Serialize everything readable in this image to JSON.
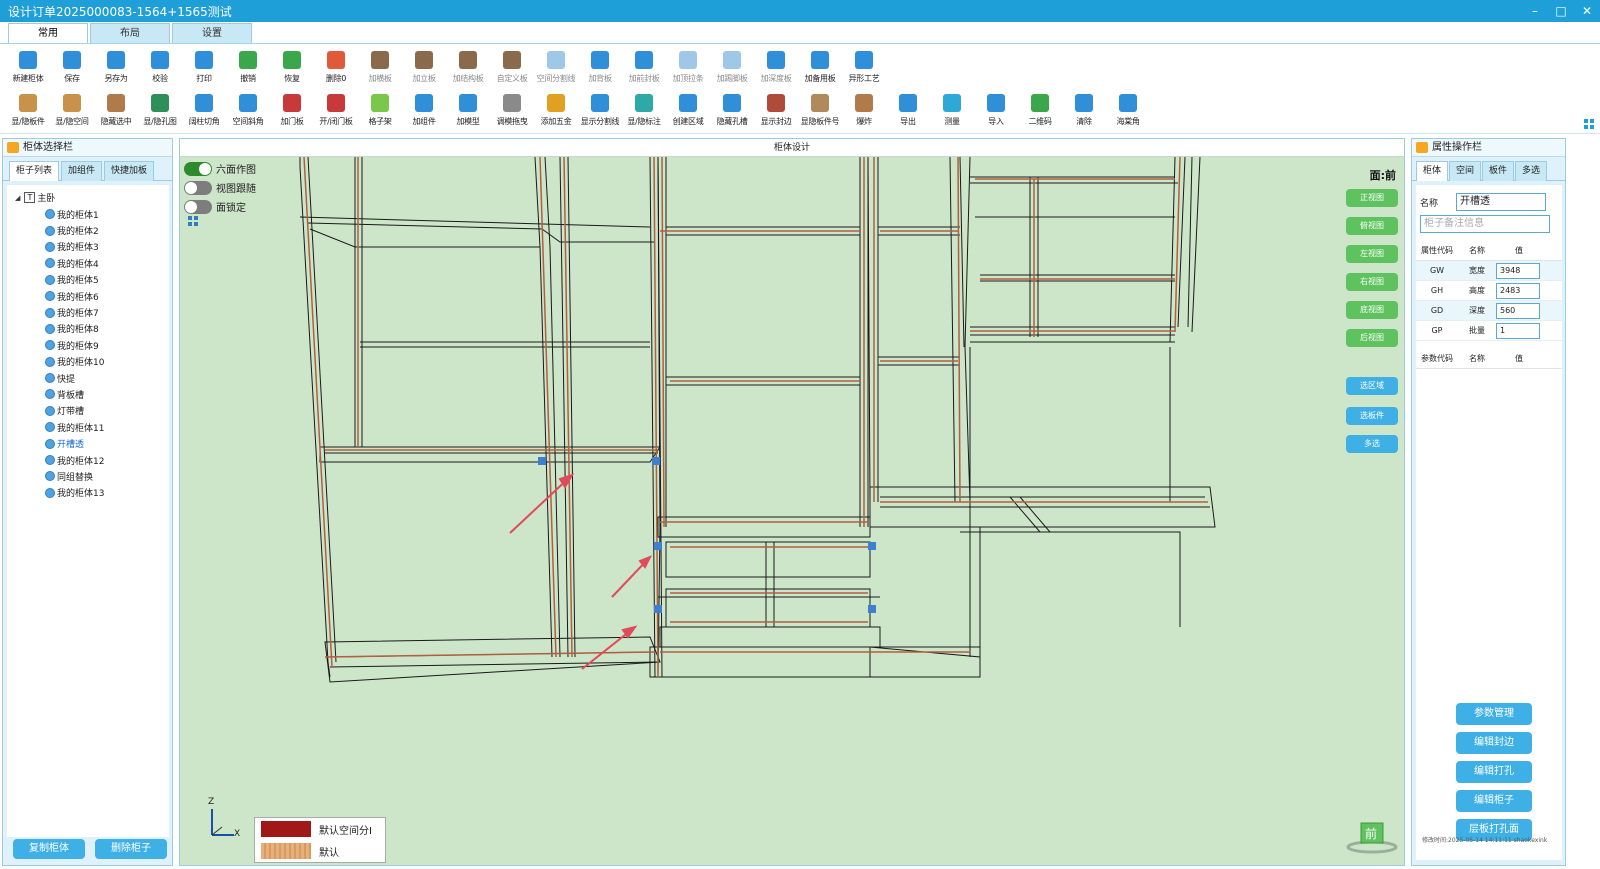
{
  "window": {
    "title": "设计订单2025000083-1564+1565测试",
    "controls": [
      "–",
      "□",
      "✕"
    ]
  },
  "ribbon": {
    "tabs": [
      "常用",
      "布局",
      "设置"
    ],
    "active_tab": "常用",
    "row1": [
      {
        "label": "新建柜体",
        "icon": "new-cabinet-icon",
        "color": "#2f8fd8",
        "dim": false
      },
      {
        "label": "保存",
        "icon": "save-icon",
        "color": "#2f8fd8",
        "dim": false
      },
      {
        "label": "另存为",
        "icon": "save-as-icon",
        "color": "#2f8fd8",
        "dim": false
      },
      {
        "label": "校验",
        "icon": "check-icon",
        "color": "#2f8fd8",
        "dim": false
      },
      {
        "label": "打印",
        "icon": "print-icon",
        "color": "#2f8fd8",
        "dim": false
      },
      {
        "label": "撤销",
        "icon": "undo-icon",
        "color": "#3aa84a",
        "dim": false
      },
      {
        "label": "恢复",
        "icon": "redo-icon",
        "color": "#3aa84a",
        "dim": false
      },
      {
        "label": "删除0",
        "icon": "delete-icon",
        "color": "#e05a3a",
        "dim": false
      },
      {
        "label": "加横板",
        "icon": "add-horizontal-board-icon",
        "color": "#8a6a4a",
        "dim": true
      },
      {
        "label": "加立板",
        "icon": "add-vertical-board-icon",
        "color": "#8a6a4a",
        "dim": true
      },
      {
        "label": "加结构板",
        "icon": "add-structure-board-icon",
        "color": "#8a6a4a",
        "dim": true
      },
      {
        "label": "自定义板",
        "icon": "custom-board-icon",
        "color": "#8a6a4a",
        "dim": true
      },
      {
        "label": "空间分割线",
        "icon": "space-split-line-icon",
        "color": "#9fc8e8",
        "dim": true
      },
      {
        "label": "加背板",
        "icon": "add-back-board-icon",
        "color": "#2f8fd8",
        "dim": true
      },
      {
        "label": "加前封板",
        "icon": "add-front-seal-board-icon",
        "color": "#2f8fd8",
        "dim": true
      },
      {
        "label": "加顶拉条",
        "icon": "add-top-strip-icon",
        "color": "#9fc8e8",
        "dim": true
      },
      {
        "label": "加踢脚板",
        "icon": "add-kick-board-icon",
        "color": "#9fc8e8",
        "dim": true
      },
      {
        "label": "加深度板",
        "icon": "add-depth-board-icon",
        "color": "#2f8fd8",
        "dim": true
      },
      {
        "label": "加备用板",
        "icon": "add-spare-board-icon",
        "color": "#2f8fd8",
        "dim": false
      },
      {
        "label": "异形工艺",
        "icon": "special-process-icon",
        "color": "#2f8fd8",
        "dim": false
      }
    ],
    "row2": [
      {
        "label": "显/隐板件",
        "icon": "toggle-boards-icon",
        "color": "#c8924a"
      },
      {
        "label": "显/隐空间",
        "icon": "toggle-space-icon",
        "color": "#c8924a"
      },
      {
        "label": "隐藏选中",
        "icon": "hide-selected-icon",
        "color": "#b07a4a"
      },
      {
        "label": "显/隐孔图",
        "icon": "toggle-hole-map-icon",
        "color": "#2f8f5a"
      },
      {
        "label": "阔柱切角",
        "icon": "column-cut-corner-icon",
        "color": "#2f8fd8"
      },
      {
        "label": "空间斜角",
        "icon": "space-bevel-icon",
        "color": "#2f8fd8"
      },
      {
        "label": "加门板",
        "icon": "add-door-icon",
        "color": "#c83a3a"
      },
      {
        "label": "开/闭门板",
        "icon": "open-close-door-icon",
        "color": "#c83a3a"
      },
      {
        "label": "格子架",
        "icon": "grid-rack-icon",
        "color": "#7ac84a"
      },
      {
        "label": "加组件",
        "icon": "add-component-icon",
        "color": "#2f8fd8"
      },
      {
        "label": "加模型",
        "icon": "add-model-icon",
        "color": "#2f8fd8"
      },
      {
        "label": "调模拖曳",
        "icon": "drag-model-icon",
        "color": "#8a8a8a"
      },
      {
        "label": "添加五金",
        "icon": "add-hardware-icon",
        "color": "#e0a020"
      },
      {
        "label": "显示分割线",
        "icon": "show-split-line-icon",
        "color": "#2f8fd8"
      },
      {
        "label": "显/隐标注",
        "icon": "toggle-annotation-icon",
        "color": "#2fa8a8"
      },
      {
        "label": "创建区域",
        "icon": "create-region-icon",
        "color": "#2f8fd8"
      },
      {
        "label": "隐藏孔槽",
        "icon": "hide-holes-icon",
        "color": "#2f8fd8"
      },
      {
        "label": "显示封边",
        "icon": "show-edge-banding-icon",
        "color": "#b04a3a"
      },
      {
        "label": "显隐板件号",
        "icon": "toggle-board-number-icon",
        "color": "#b08a5a"
      },
      {
        "label": "爆炸",
        "icon": "explode-icon",
        "color": "#b07a4a"
      },
      {
        "label": "导出",
        "icon": "export-icon",
        "color": "#2f8fd8"
      },
      {
        "label": "测量",
        "icon": "measure-icon",
        "color": "#2fa8d8"
      },
      {
        "label": "导入",
        "icon": "import-icon",
        "color": "#2f8fd8"
      },
      {
        "label": "二维码",
        "icon": "qr-code-icon",
        "color": "#3aa84a"
      },
      {
        "label": "清除",
        "icon": "clear-icon",
        "color": "#2f8fd8"
      },
      {
        "label": "海棠角",
        "icon": "crabapple-corner-icon",
        "color": "#2f8fd8"
      }
    ]
  },
  "left_panel": {
    "title": "柜体选择栏",
    "tabs": [
      "柜子列表",
      "加组件",
      "快捷加板"
    ],
    "active_tab": "柜子列表",
    "tree_root": "主卧",
    "items": [
      "我的柜体1",
      "我的柜体2",
      "我的柜体3",
      "我的柜体4",
      "我的柜体5",
      "我的柜体6",
      "我的柜体7",
      "我的柜体8",
      "我的柜体9",
      "我的柜体10",
      "快提",
      "背板槽",
      "灯带槽",
      "我的柜体11",
      "开槽透",
      "我的柜体12",
      "同组替换",
      "我的柜体13"
    ],
    "selected_item": "开槽透",
    "copy_button": "复制柜体",
    "delete_button": "删除柜子"
  },
  "center": {
    "title": "柜体设计",
    "toggles": [
      {
        "label": "六面作图",
        "on": true
      },
      {
        "label": "视图跟随",
        "on": false
      },
      {
        "label": "面锁定",
        "on": false
      }
    ],
    "face_label": "面:前",
    "view_buttons": [
      "正视图",
      "俯视图",
      "左视图",
      "右视图",
      "底视图",
      "后视图"
    ],
    "select_buttons": [
      "选区域",
      "选板件",
      "多选"
    ],
    "legend": [
      {
        "label": "默认空间分I",
        "color": "#a01818"
      },
      {
        "label": "默认",
        "color": "#e6b07a"
      }
    ],
    "axis_labels": {
      "z": "Z",
      "x": "X"
    },
    "front_icon": "前"
  },
  "right_panel": {
    "title": "属性操作栏",
    "tabs": [
      "柜体",
      "空间",
      "板件",
      "多选"
    ],
    "active_tab": "柜体",
    "name_label": "名称",
    "name_value": "开槽透",
    "note_placeholder": "柜子备注信息",
    "prop_headers": [
      "属性代码",
      "名称",
      "值"
    ],
    "props": [
      {
        "code": "GW",
        "name": "宽度",
        "value": "3948"
      },
      {
        "code": "GH",
        "name": "高度",
        "value": "2483"
      },
      {
        "code": "GD",
        "name": "深度",
        "value": "560"
      },
      {
        "code": "GP",
        "name": "批量",
        "value": "1"
      }
    ],
    "param_headers": [
      "参数代码",
      "名称",
      "值"
    ],
    "actions": [
      "参数管理",
      "编辑封边",
      "编辑打孔",
      "编辑柜子",
      "层板打孔面"
    ],
    "footer": "修改时间:2025-05-14 14:11:11 shaokexink"
  },
  "colors": {
    "accent": "#1e9fd8",
    "canvas_bg": "#cde5c8",
    "view_button": "#5ec25e",
    "action_button": "#3fb0e6",
    "board_line": "#b06040"
  }
}
